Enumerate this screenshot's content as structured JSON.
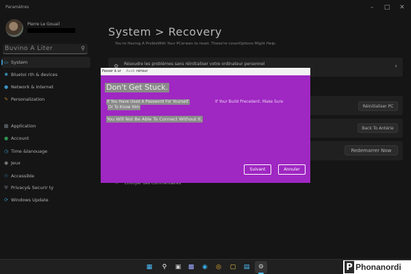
{
  "window": {
    "title": "Paramètres"
  },
  "profile": {
    "name": "Pierre Le Gouail"
  },
  "search": {
    "placeholder": "Buvino A Liter"
  },
  "sidebar": {
    "items": [
      {
        "label": "System",
        "icon": "monitor-icon",
        "active": true
      },
      {
        "label": "Bluetoi  rth & devices",
        "icon": "bluetooth-icon"
      },
      {
        "label": "Network & Internet",
        "icon": "wifi-icon"
      },
      {
        "label": "Personalization",
        "icon": "brush-icon"
      },
      {
        "label": "Application",
        "icon": "apps-icon"
      },
      {
        "label": "Account",
        "icon": "person-icon"
      },
      {
        "label": "Time &lanouage",
        "icon": "globe-clock-icon"
      },
      {
        "label": "Jeux",
        "icon": "gamepad-icon"
      },
      {
        "label": "Accessible",
        "icon": "accessibility-icon"
      },
      {
        "label": "Privacy& Securir  ty",
        "icon": "shield-icon"
      },
      {
        "label": "Windows Update",
        "icon": "update-icon"
      }
    ]
  },
  "main": {
    "title": "System > Recovery",
    "subtitle": "You're Having A ProbleWith Your PCerwan  to reset. These're coverOptions Might Help.",
    "fix_card": {
      "label": "Résoudre les problèmes sans réinitialiser votre ordinateur personnel"
    },
    "reset_button": "Réinitialiser PC",
    "advanced_button": "Back To Antérie",
    "restart_button": "Redemarrer Now",
    "feedback": "Envoyer des commentaires"
  },
  "dialog": {
    "header_part1": "Passer à ur",
    "header_part2": "Auxb",
    "header_part3": "rérieur",
    "heading": "Don't Get Stuck.",
    "body_line1_a": "If You Have Used A Password For Yourself.",
    "body_line1_b": "If Your Build Precedent. Make Sure",
    "body_line2": "Or To Know Him",
    "body_line3": "You Will Not Be Able To Connect Without It.",
    "next_button": "Suivant",
    "cancel_button": "Annuler"
  },
  "watermark": {
    "letter": "P",
    "text": "Phonanordi"
  },
  "colors": {
    "dialog_bg": "#9f27c2",
    "accent": "#4cc2ff",
    "app_bg": "#1c1c1c"
  }
}
